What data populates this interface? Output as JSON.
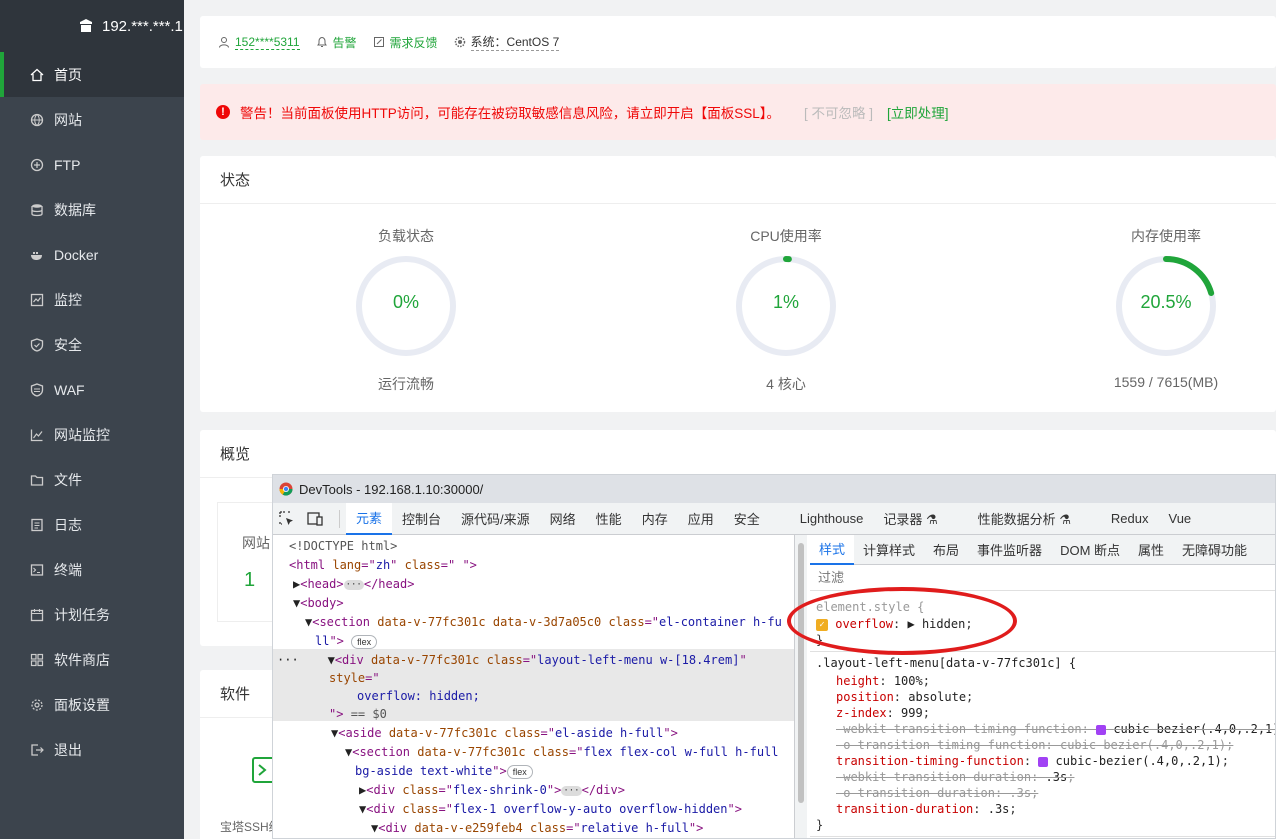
{
  "sidebar": {
    "server": "192.***.***.1",
    "items": [
      {
        "label": "首页",
        "icon": "home-icon"
      },
      {
        "label": "网站",
        "icon": "globe-icon"
      },
      {
        "label": "FTP",
        "icon": "ftp-icon"
      },
      {
        "label": "数据库",
        "icon": "database-icon"
      },
      {
        "label": "Docker",
        "icon": "docker-icon"
      },
      {
        "label": "监控",
        "icon": "monitor-icon"
      },
      {
        "label": "安全",
        "icon": "shield-icon"
      },
      {
        "label": "WAF",
        "icon": "waf-icon"
      },
      {
        "label": "网站监控",
        "icon": "chart-icon"
      },
      {
        "label": "文件",
        "icon": "folder-icon"
      },
      {
        "label": "日志",
        "icon": "log-icon"
      },
      {
        "label": "终端",
        "icon": "terminal-icon"
      },
      {
        "label": "计划任务",
        "icon": "calendar-icon"
      },
      {
        "label": "软件商店",
        "icon": "apps-icon"
      },
      {
        "label": "面板设置",
        "icon": "gear-icon"
      },
      {
        "label": "退出",
        "icon": "logout-icon"
      }
    ]
  },
  "topbar": {
    "user": "152****5311",
    "alarm": "告警",
    "feedback": "需求反馈",
    "system": "系统：CentOS 7"
  },
  "warning": {
    "text": "警告！当前面板使用HTTP访问，可能存在被窃取敏感信息风险，请立即开启【面板SSL】。",
    "ignore": "[ 不可忽略 ]",
    "fix": "[立即处理]"
  },
  "status": {
    "title": "状态",
    "gauges": [
      {
        "title": "负载状态",
        "value": "0%",
        "sub": "运行流畅",
        "fraction": 0.0
      },
      {
        "title": "CPU使用率",
        "value": "1%",
        "sub": "4 核心",
        "fraction": 0.01
      },
      {
        "title": "内存使用率",
        "value": "20.5%",
        "sub": "1559 / 7615(MB)",
        "fraction": 0.205
      }
    ]
  },
  "overview": {
    "title": "概览",
    "site_label": "网站",
    "site_value": "1"
  },
  "software": {
    "title": "软件",
    "item_label": "宝塔SSH终"
  },
  "devtools": {
    "title": "DevTools - 192.168.1.10:30000/",
    "tabs": [
      "元素",
      "控制台",
      "源代码/来源",
      "网络",
      "性能",
      "内存",
      "应用",
      "安全",
      "Lighthouse",
      "记录器 ⚗",
      "性能数据分析 ⚗",
      "Redux",
      "Vue"
    ],
    "style_tabs": [
      "样式",
      "计算样式",
      "布局",
      "事件监听器",
      "DOM 断点",
      "属性",
      "无障碍功能"
    ],
    "filter_placeholder": "过滤",
    "colors": {
      "accent": "#1a73e8",
      "tag": "#881280",
      "attr_name": "#994500",
      "attr_value": "#1a1aa6",
      "prop": "#c80000"
    }
  },
  "colors": {
    "brand": "#20a53a",
    "sidebar": "#3c444d",
    "danger": "#ef0808"
  }
}
